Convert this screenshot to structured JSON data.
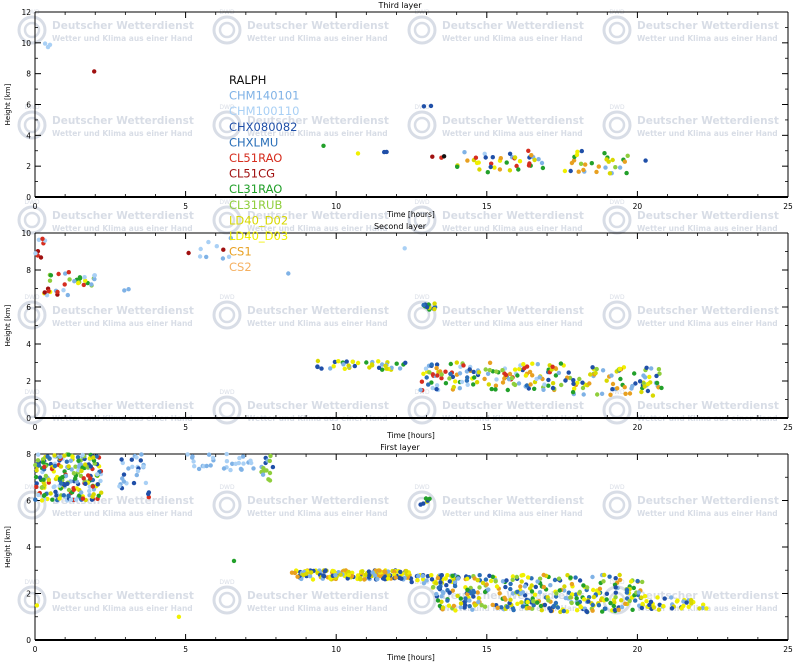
{
  "watermark": {
    "line1": "Deutscher Wetterdienst",
    "line2": "Wetter und Klima aus einer Hand",
    "logo_text": "DWD",
    "color": "#d8dde6"
  },
  "legend": {
    "placement": "upper-left of top panel, overlapping lower panels",
    "items": [
      {
        "name": "RALPH",
        "color": "#111111"
      },
      {
        "name": "CHM140101",
        "color": "#7fb2e6"
      },
      {
        "name": "CHM100110",
        "color": "#a9d0f5"
      },
      {
        "name": "CHX080082",
        "color": "#1f4fa8"
      },
      {
        "name": "CHXLMU",
        "color": "#2a6fb8"
      },
      {
        "name": "CL51RAO",
        "color": "#d62e1f"
      },
      {
        "name": "CL51CG",
        "color": "#a01010"
      },
      {
        "name": "CL31RAO",
        "color": "#22a02a"
      },
      {
        "name": "CL31RUB",
        "color": "#8fce3c"
      },
      {
        "name": "LD40_D02",
        "color": "#d8d800"
      },
      {
        "name": "LD40_D03",
        "color": "#f0f000"
      },
      {
        "name": "CS1",
        "color": "#e8a020"
      },
      {
        "name": "CS2",
        "color": "#f5b060"
      }
    ]
  },
  "chart_data": [
    {
      "type": "scatter",
      "title": "Third layer",
      "xlabel": "Time [hours]",
      "ylabel": "Height [km]",
      "xlim": [
        0,
        25
      ],
      "ylim": [
        0,
        12
      ],
      "xticks": [
        "0",
        "5",
        "10",
        "15",
        "20",
        "25"
      ],
      "yticks": [
        "0",
        "2",
        "4",
        "6",
        "8",
        "10",
        "12"
      ],
      "grid": false,
      "clusters": [
        {
          "x": [
            0.3,
            0.5
          ],
          "y": [
            9.6,
            10.0
          ],
          "n": 3,
          "series": [
            2
          ]
        },
        {
          "x": [
            1.8,
            2.0
          ],
          "y": [
            8.0,
            8.2
          ],
          "n": 1,
          "series": [
            6
          ]
        },
        {
          "x": [
            9.5,
            9.6
          ],
          "y": [
            3.3,
            3.4
          ],
          "n": 1,
          "series": [
            7
          ]
        },
        {
          "x": [
            10.7,
            10.8
          ],
          "y": [
            2.8,
            2.95
          ],
          "n": 1,
          "series": [
            10
          ]
        },
        {
          "x": [
            11.5,
            11.7
          ],
          "y": [
            2.8,
            2.95
          ],
          "n": 2,
          "series": [
            3,
            7
          ]
        },
        {
          "x": [
            12.8,
            13.2
          ],
          "y": [
            5.7,
            6.2
          ],
          "n": 2,
          "series": [
            3
          ]
        },
        {
          "x": [
            13.0,
            13.6
          ],
          "y": [
            2.5,
            2.8
          ],
          "n": 3,
          "series": [
            5,
            6,
            0
          ]
        },
        {
          "x": [
            14.0,
            17.0
          ],
          "y": [
            1.6,
            3.0
          ],
          "n": 40,
          "series": [
            1,
            2,
            3,
            5,
            7,
            9,
            10,
            11
          ]
        },
        {
          "x": [
            17.3,
            19.7
          ],
          "y": [
            1.5,
            3.0
          ],
          "n": 30,
          "series": [
            1,
            3,
            7,
            8,
            9,
            10,
            11
          ]
        },
        {
          "x": [
            20.0,
            20.3
          ],
          "y": [
            2.2,
            2.4
          ],
          "n": 1,
          "series": [
            3
          ]
        }
      ]
    },
    {
      "type": "scatter",
      "title": "Second layer",
      "xlabel": "Time [hours]",
      "ylabel": "Height [km]",
      "xlim": [
        0,
        25
      ],
      "ylim": [
        0,
        10
      ],
      "xticks": [
        "0",
        "5",
        "10",
        "15",
        "20",
        "25"
      ],
      "yticks": [
        "0",
        "2",
        "4",
        "6",
        "8",
        "10"
      ],
      "grid": false,
      "clusters": [
        {
          "x": [
            0.0,
            0.4
          ],
          "y": [
            8.6,
            9.8
          ],
          "n": 8,
          "series": [
            5,
            6,
            1,
            2
          ]
        },
        {
          "x": [
            0.3,
            2.0
          ],
          "y": [
            6.6,
            8.0
          ],
          "n": 35,
          "series": [
            5,
            6,
            7,
            8,
            1,
            2,
            10
          ]
        },
        {
          "x": [
            2.9,
            3.2
          ],
          "y": [
            6.8,
            7.0
          ],
          "n": 2,
          "series": [
            1
          ]
        },
        {
          "x": [
            5.0,
            6.6
          ],
          "y": [
            8.6,
            10.0
          ],
          "n": 10,
          "series": [
            1,
            2,
            6
          ]
        },
        {
          "x": [
            8.4,
            8.7
          ],
          "y": [
            7.7,
            7.9
          ],
          "n": 1,
          "series": [
            1
          ]
        },
        {
          "x": [
            12.2,
            12.3
          ],
          "y": [
            9.0,
            9.2
          ],
          "n": 1,
          "series": [
            2
          ]
        },
        {
          "x": [
            12.9,
            13.3
          ],
          "y": [
            5.8,
            6.2
          ],
          "n": 12,
          "series": [
            3,
            4,
            7,
            9
          ]
        },
        {
          "x": [
            9.3,
            12.3
          ],
          "y": [
            2.6,
            3.1
          ],
          "n": 40,
          "series": [
            1,
            3,
            9,
            10,
            7
          ]
        },
        {
          "x": [
            12.8,
            17.6
          ],
          "y": [
            1.5,
            3.0
          ],
          "n": 140,
          "series": [
            1,
            2,
            3,
            4,
            5,
            7,
            8,
            9,
            10,
            11
          ]
        },
        {
          "x": [
            17.6,
            20.9
          ],
          "y": [
            1.2,
            2.8
          ],
          "n": 80,
          "series": [
            1,
            3,
            7,
            8,
            9,
            10,
            11
          ]
        }
      ]
    },
    {
      "type": "scatter",
      "title": "First layer",
      "xlabel": "Time [hours]",
      "ylabel": "Height [km]",
      "xlim": [
        0,
        25
      ],
      "ylim": [
        0,
        8
      ],
      "xticks": [
        "0",
        "5",
        "10",
        "15",
        "20",
        "25"
      ],
      "yticks": [
        "0",
        "2",
        "4",
        "6",
        "8"
      ],
      "grid": false,
      "clusters": [
        {
          "x": [
            0.0,
            2.2
          ],
          "y": [
            6.0,
            8.0
          ],
          "n": 220,
          "series": [
            3,
            4,
            7,
            8,
            5,
            1,
            2,
            9,
            10
          ]
        },
        {
          "x": [
            2.8,
            3.7
          ],
          "y": [
            6.4,
            8.0
          ],
          "n": 25,
          "series": [
            1,
            2,
            3
          ]
        },
        {
          "x": [
            3.7,
            3.8
          ],
          "y": [
            6.0,
            6.4
          ],
          "n": 3,
          "series": [
            3,
            5
          ]
        },
        {
          "x": [
            5.0,
            7.5
          ],
          "y": [
            7.3,
            8.0
          ],
          "n": 30,
          "series": [
            1,
            2
          ]
        },
        {
          "x": [
            7.5,
            7.9
          ],
          "y": [
            6.8,
            8.0
          ],
          "n": 15,
          "series": [
            3,
            7,
            8,
            1
          ]
        },
        {
          "x": [
            0.0,
            0.1
          ],
          "y": [
            1.3,
            1.5
          ],
          "n": 1,
          "series": [
            10
          ]
        },
        {
          "x": [
            4.7,
            4.8
          ],
          "y": [
            0.8,
            1.0
          ],
          "n": 1,
          "series": [
            10
          ]
        },
        {
          "x": [
            6.6,
            6.7
          ],
          "y": [
            3.4,
            3.5
          ],
          "n": 1,
          "series": [
            7
          ]
        },
        {
          "x": [
            12.8,
            13.2
          ],
          "y": [
            5.8,
            6.1
          ],
          "n": 6,
          "series": [
            3,
            7,
            9
          ]
        },
        {
          "x": [
            8.5,
            12.5
          ],
          "y": [
            2.6,
            3.0
          ],
          "n": 180,
          "series": [
            10,
            9,
            3,
            1,
            11
          ]
        },
        {
          "x": [
            12.5,
            14.0
          ],
          "y": [
            2.4,
            2.8
          ],
          "n": 40,
          "series": [
            10,
            9,
            3,
            1
          ]
        },
        {
          "x": [
            13.2,
            20.2
          ],
          "y": [
            1.2,
            2.8
          ],
          "n": 320,
          "series": [
            10,
            9,
            3,
            1,
            7,
            8,
            11,
            4
          ]
        },
        {
          "x": [
            20.0,
            22.3
          ],
          "y": [
            1.3,
            1.9
          ],
          "n": 40,
          "series": [
            10,
            9,
            3,
            1
          ]
        }
      ]
    }
  ]
}
